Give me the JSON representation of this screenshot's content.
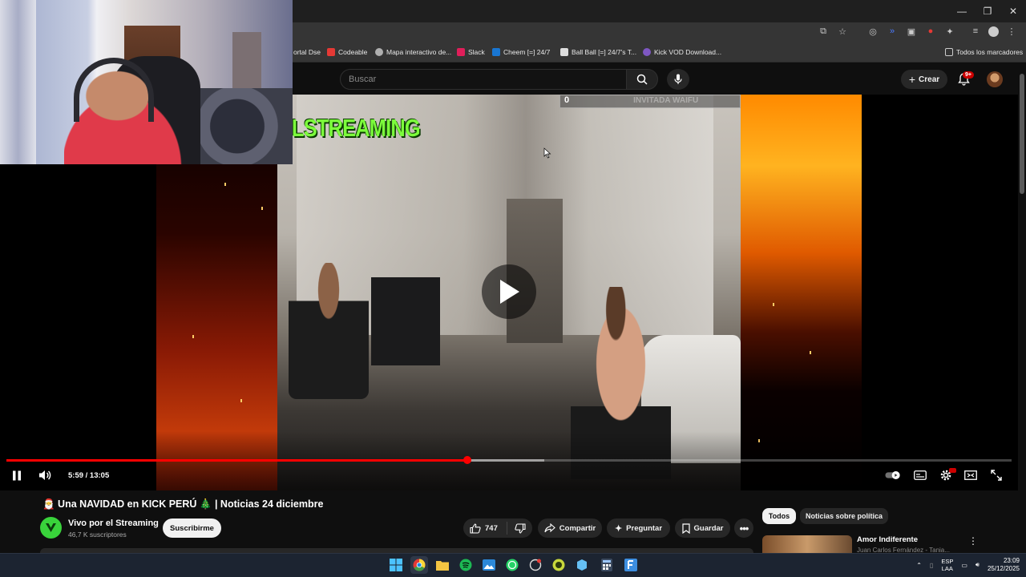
{
  "browser": {
    "window_controls": [
      "—",
      "❐",
      "✕"
    ],
    "bookmarks": [
      {
        "label": "ortal Dse",
        "color": "#3a78d8"
      },
      {
        "label": "Codeable",
        "color": "#e53935"
      },
      {
        "label": "Mapa interactivo de...",
        "color": "#b0b0b0"
      },
      {
        "label": "Slack",
        "color": "#e01e5a"
      },
      {
        "label": "Cheem [=] 24/7",
        "color": "#1976d2"
      },
      {
        "label": "Ball Ball [=] 24/7's T...",
        "color": "#dddddd"
      },
      {
        "label": "Kick VOD Download...",
        "color": "#7e57c2"
      }
    ],
    "all_bookmarks": "Todos los marcadores"
  },
  "header": {
    "search_placeholder": "Buscar",
    "create_label": "Crear",
    "notification_badge": "9+"
  },
  "player": {
    "overlay_text": "LSTREAMING",
    "overlay_counter": "0",
    "overlay_faded": "INVITADA WAIFU",
    "current_time": "5:59",
    "duration": "13:05",
    "time_display": "5:59 / 13:05",
    "progress_fraction": 0.4585,
    "buffer_fraction": 0.535
  },
  "video": {
    "title": "🎅 Una NAVIDAD en KICK PERÚ 🎄 | Noticias 24 diciembre",
    "channel_name": "Vivo por el Streaming",
    "channel_subscribers": "46,7 K suscriptores",
    "subscribe_label": "Suscribirme",
    "likes": "747",
    "share_label": "Compartir",
    "ask_label": "Preguntar",
    "save_label": "Guardar"
  },
  "sidebar": {
    "chips": [
      "Todos",
      "Noticias sobre política"
    ],
    "recommendation": {
      "title": "Amor Indiferente",
      "channel": "Juan Carlos Fernández - Tania..."
    }
  },
  "taskbar": {
    "language_line1": "ESP",
    "language_line2": "LAA",
    "time": "23:09",
    "date": "25/12/2025"
  }
}
